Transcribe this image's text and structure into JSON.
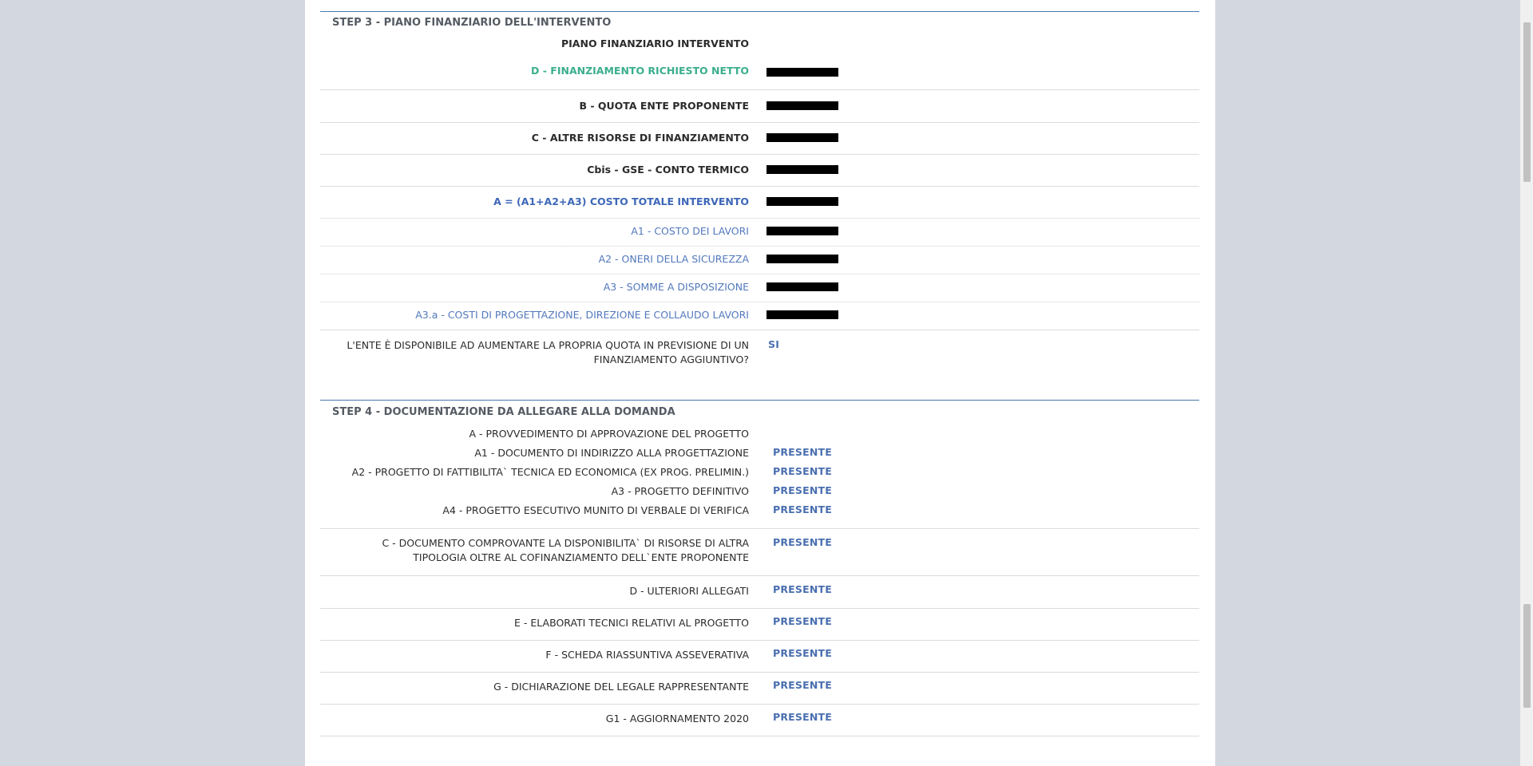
{
  "step3": {
    "title": "STEP 3 - PIANO FINANZIARIO DELL'INTERVENTO",
    "subheading": "PIANO FINANZIARIO INTERVENTO",
    "rows": [
      {
        "label": "D - FINANZIAMENTO RICHIESTO NETTO"
      },
      {
        "label": "B - QUOTA ENTE PROPONENTE"
      },
      {
        "label": "C - ALTRE RISORSE DI FINANZIAMENTO"
      },
      {
        "label": "Cbis - GSE - CONTO TERMICO"
      },
      {
        "label": "A = (A1+A2+A3) COSTO TOTALE INTERVENTO"
      },
      {
        "label": "A1 - COSTO DEI LAVORI"
      },
      {
        "label": "A2 - ONERI DELLA SICUREZZA"
      },
      {
        "label": "A3 - SOMME A DISPOSIZIONE"
      },
      {
        "label": "A3.a - COSTI DI PROGETTAZIONE, DIREZIONE E COLLAUDO LAVORI"
      }
    ],
    "question": {
      "label": "L'ENTE È DISPONIBILE AD AUMENTARE LA PROPRIA QUOTA IN PREVISIONE DI UN FINANZIAMENTO AGGIUNTIVO?",
      "value": "SI"
    }
  },
  "step4": {
    "title": "STEP 4 - DOCUMENTAZIONE DA ALLEGARE ALLA DOMANDA",
    "group_a": {
      "heading": "A - PROVVEDIMENTO DI APPROVAZIONE DEL PROGETTO",
      "items": [
        {
          "label": "A1 - DOCUMENTO DI INDIRIZZO ALLA PROGETTAZIONE",
          "value": "PRESENTE"
        },
        {
          "label": "A2 - PROGETTO DI FATTIBILITA` TECNICA ED ECONOMICA (EX PROG. PRELIMIN.)",
          "value": "PRESENTE"
        },
        {
          "label": "A3 - PROGETTO DEFINITIVO",
          "value": "PRESENTE"
        },
        {
          "label": "A4 - PROGETTO ESECUTIVO MUNITO DI VERBALE DI VERIFICA",
          "value": "PRESENTE"
        }
      ]
    },
    "docs": [
      {
        "label": "C - DOCUMENTO COMPROVANTE LA DISPONIBILITA` DI RISORSE DI ALTRA TIPOLOGIA OLTRE AL COFINANZIAMENTO DELL`ENTE PROPONENTE",
        "value": "PRESENTE"
      },
      {
        "label": "D - ULTERIORI ALLEGATI",
        "value": "PRESENTE"
      },
      {
        "label": "E - ELABORATI TECNICI RELATIVI AL PROGETTO",
        "value": "PRESENTE"
      },
      {
        "label": "F - SCHEDA RIASSUNTIVA ASSEVERATIVA",
        "value": "PRESENTE"
      },
      {
        "label": "G - DICHIARAZIONE DEL LEGALE RAPPRESENTANTE",
        "value": "PRESENTE"
      },
      {
        "label": "G1 - AGGIORNAMENTO 2020",
        "value": "PRESENTE"
      }
    ]
  }
}
